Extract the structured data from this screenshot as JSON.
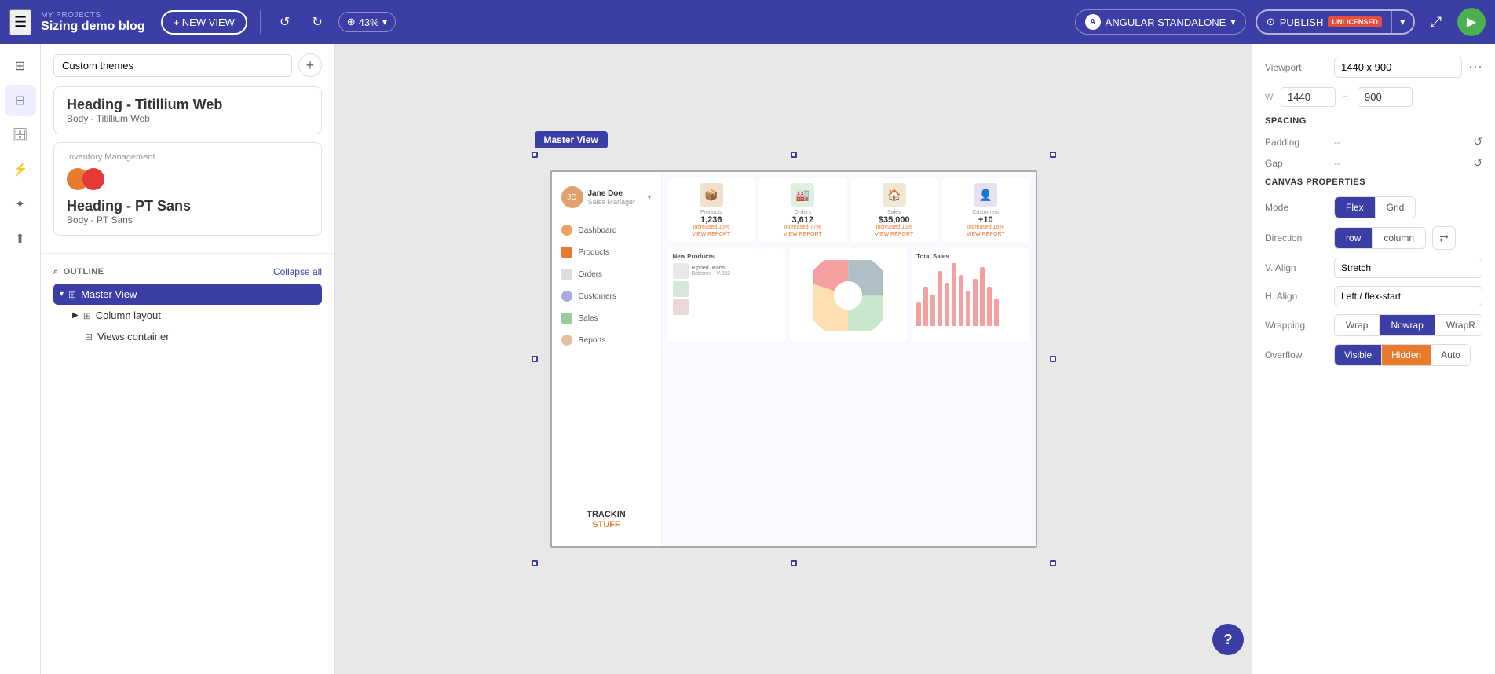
{
  "topbar": {
    "my_projects": "MY PROJECTS",
    "title": "Sizing demo blog",
    "new_view": "+ NEW VIEW",
    "zoom": "43%",
    "framework": "ANGULAR STANDALONE",
    "publish": "PUBLISH",
    "unlicensed": "UNLICENSED",
    "share_icon": "share",
    "play_icon": "▶"
  },
  "themes": {
    "section_title": "Custom themes",
    "selected_theme": "Custom themes",
    "theme1": {
      "heading": "Heading - Titillium Web",
      "body": "Body - Titillium Web"
    },
    "theme2": {
      "title": "Inventory Management",
      "heading": "Heading - PT Sans",
      "body": "Body - PT Sans"
    }
  },
  "outline": {
    "title": "OUTLINE",
    "collapse_all": "Collapse all",
    "items": [
      {
        "label": "Master View",
        "level": 0,
        "active": true,
        "expanded": true
      },
      {
        "label": "Column layout",
        "level": 1,
        "active": false,
        "expanded": true
      },
      {
        "label": "Views container",
        "level": 2,
        "active": false
      }
    ]
  },
  "canvas": {
    "view_label": "Master View",
    "preview": {
      "user_name": "Jane Doe",
      "user_role": "Sales Manager",
      "nav_items": [
        "Dashboard",
        "Products",
        "Orders",
        "Customers",
        "Sales",
        "Reports"
      ],
      "stats": [
        {
          "label": "Products",
          "value": "1,236",
          "change": "Increased 15%"
        },
        {
          "label": "Orders",
          "value": "3,612",
          "change": "Increased 77%"
        },
        {
          "label": "Sales",
          "value": "$35,000",
          "change": "Increased 15%"
        },
        {
          "label": "Customers",
          "value": "+10",
          "change": "Increased 15%"
        }
      ],
      "logo_line1": "TRACKIN",
      "logo_line2": "STUFF"
    }
  },
  "right_panel": {
    "viewport_label": "Viewport",
    "viewport_value": "1440 x 900",
    "more_icon": "⋯",
    "w_label": "W",
    "w_value": "1440",
    "h_label": "H",
    "h_value": "900",
    "spacing": {
      "title": "SPACING",
      "padding_label": "Padding",
      "padding_value": "--",
      "gap_label": "Gap",
      "gap_value": "--"
    },
    "canvas_props": {
      "title": "CANVAS PROPERTIES",
      "mode_label": "Mode",
      "flex_label": "Flex",
      "grid_label": "Grid",
      "direction_label": "Direction",
      "row_label": "row",
      "column_label": "column",
      "v_align_label": "V. Align",
      "v_align_value": "Stretch",
      "h_align_label": "H. Align",
      "h_align_value": "Left / flex-start",
      "wrapping_label": "Wrapping",
      "wrap_label": "Wrap",
      "nowrap_label": "Nowrap",
      "wraprev_label": "WrapR...",
      "overflow_label": "Overflow",
      "visible_label": "Visible",
      "hidden_label": "Hidden",
      "auto_label": "Auto"
    }
  }
}
